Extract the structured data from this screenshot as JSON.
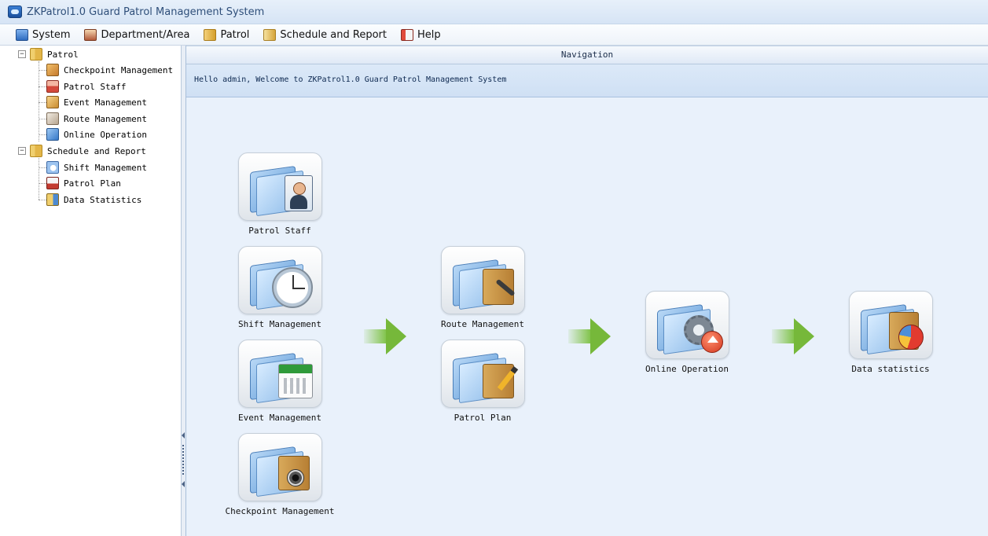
{
  "window": {
    "title": "ZKPatrol1.0 Guard Patrol Management System"
  },
  "menubar": {
    "items": [
      {
        "label": "System",
        "icon": "computer-icon"
      },
      {
        "label": "Department/Area",
        "icon": "department-icon"
      },
      {
        "label": "Patrol",
        "icon": "patrol-folder-icon"
      },
      {
        "label": "Schedule and Report",
        "icon": "schedule-folder-icon"
      },
      {
        "label": "Help",
        "icon": "help-book-icon"
      }
    ]
  },
  "tree": {
    "groups": [
      {
        "label": "Patrol",
        "expander": "−",
        "children": [
          {
            "label": "Checkpoint Management",
            "icon": "checkpoint-icon"
          },
          {
            "label": "Patrol Staff",
            "icon": "staff-icon"
          },
          {
            "label": "Event Management",
            "icon": "event-icon"
          },
          {
            "label": "Route Management",
            "icon": "route-icon"
          },
          {
            "label": "Online Operation",
            "icon": "online-icon"
          }
        ]
      },
      {
        "label": "Schedule and Report",
        "expander": "−",
        "children": [
          {
            "label": "Shift Management",
            "icon": "shift-icon"
          },
          {
            "label": "Patrol Plan",
            "icon": "plan-icon"
          },
          {
            "label": "Data Statistics",
            "icon": "statistics-icon"
          }
        ]
      }
    ]
  },
  "main": {
    "header": "Navigation",
    "welcome": "Hello admin, Welcome to ZKPatrol1.0 Guard Patrol Management System",
    "tiles": {
      "patrol_staff": "Patrol Staff",
      "shift_management": "Shift Management",
      "event_management": "Event Management",
      "checkpoint_management": "Checkpoint Management",
      "route_management": "Route Management",
      "patrol_plan": "Patrol Plan",
      "online_operation": "Online Operation",
      "data_statistics": "Data statistics"
    }
  },
  "colors": {
    "main_background": "#e9f1fb",
    "welcome_bar": "#d6e6f7",
    "arrow_green": "#76b83a"
  }
}
